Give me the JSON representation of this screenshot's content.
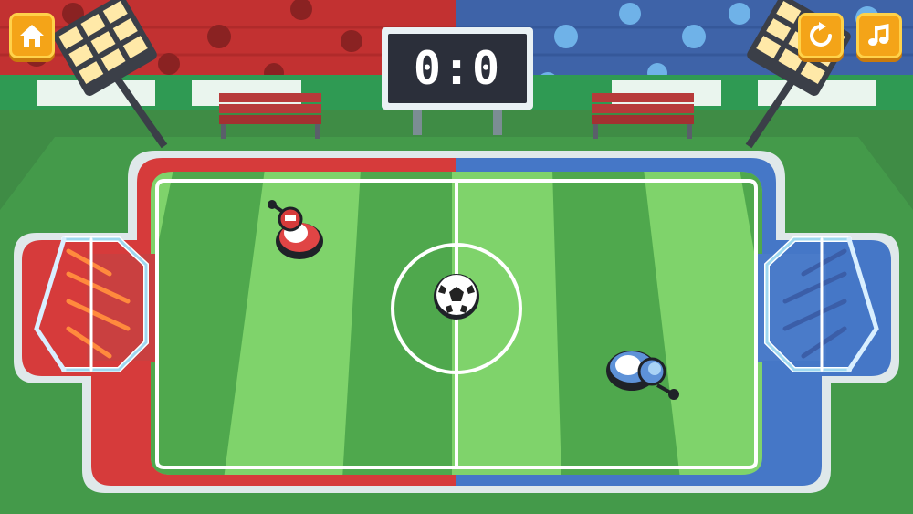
{
  "game": {
    "score": {
      "display": "0:0",
      "red": 0,
      "blue": 0
    },
    "teams": {
      "left": {
        "color": "#d63b3b",
        "stand_color": "#c23131"
      },
      "right": {
        "color": "#4577c7",
        "stand_color": "#3e63a8"
      }
    },
    "pitch": {
      "light": "#7fd36b",
      "dark": "#4fa84d"
    }
  },
  "toolbar": {
    "home": {
      "icon": "home-icon"
    },
    "restart": {
      "icon": "restart-icon"
    },
    "music": {
      "icon": "music-note-icon"
    }
  },
  "colors": {
    "button": "#f4a418",
    "button_border": "#ffd24a"
  }
}
